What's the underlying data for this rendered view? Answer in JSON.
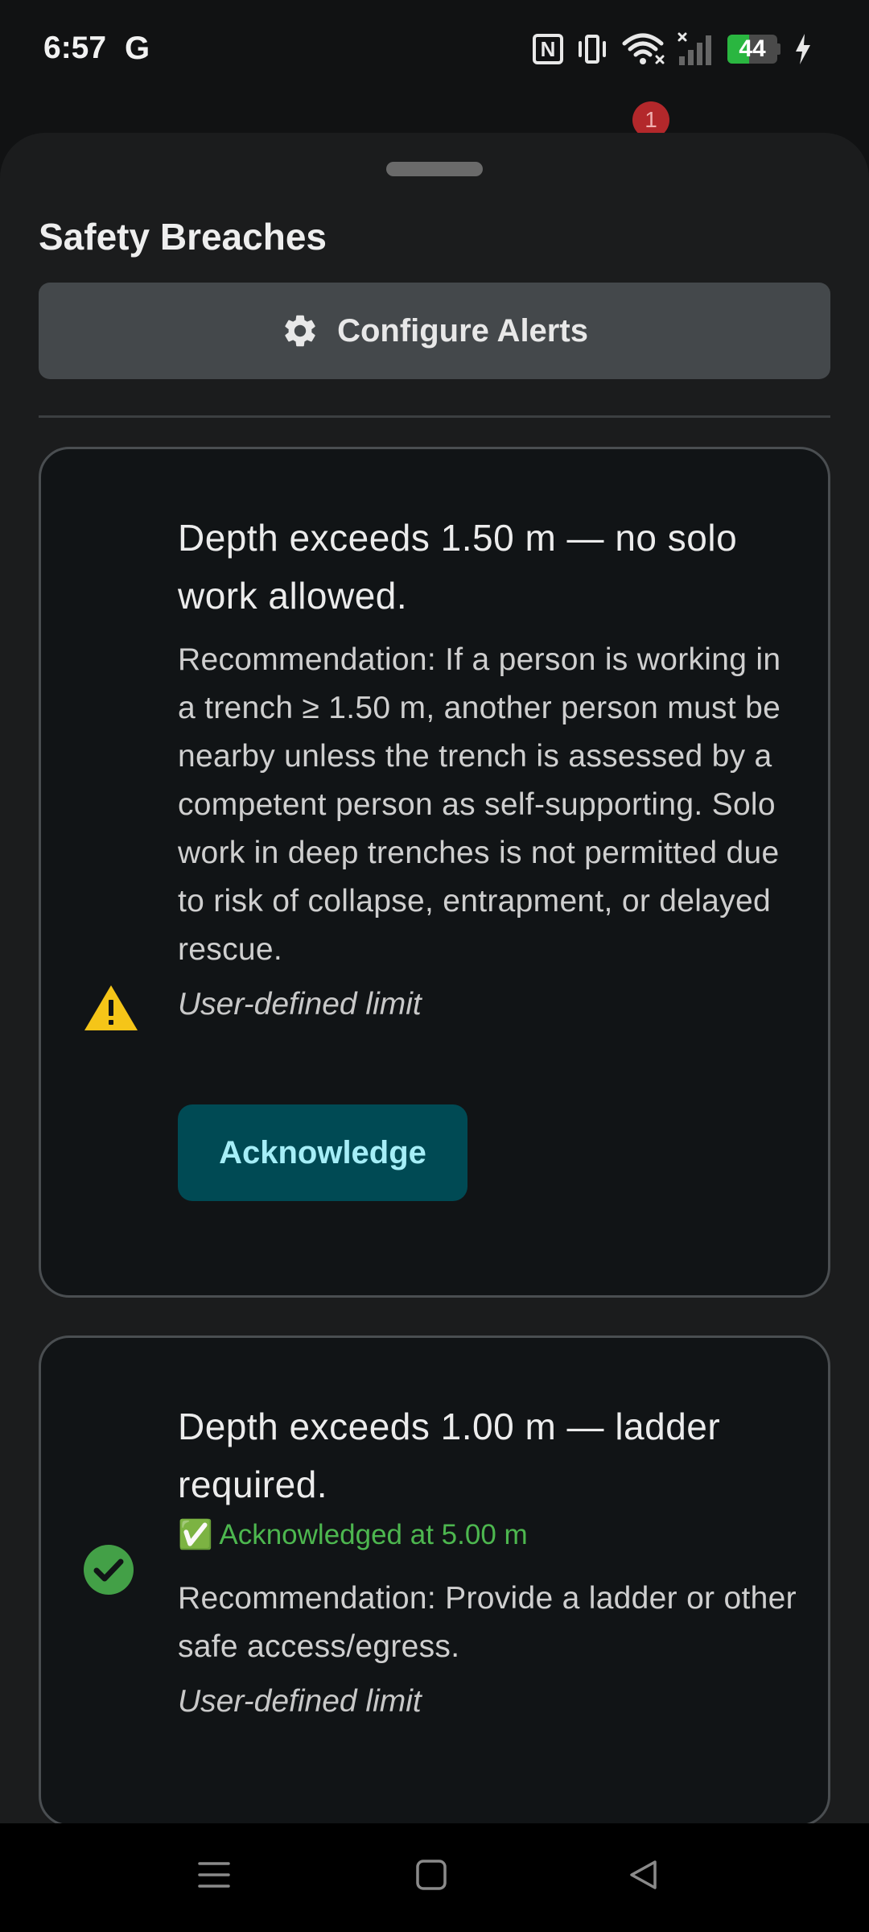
{
  "status_bar": {
    "time": "6:57",
    "google_letter": "G",
    "battery_percent": "44",
    "battery_level": 0.44,
    "icons": [
      "nfc-icon",
      "vibrate-icon",
      "wifi-icon",
      "signal-icon",
      "battery-icon",
      "charging-icon"
    ]
  },
  "background": {
    "notification_badge": "1"
  },
  "sheet": {
    "title": "Safety Breaches",
    "configure_label": "Configure Alerts",
    "configure_icon": "gear-icon"
  },
  "breaches": [
    {
      "title": "Depth exceeds 1.50 m — no solo work allowed.",
      "recommendation": "Recommendation: If a person is working in a trench ≥ 1.50 m, another person must be nearby unless the trench is assessed by a competent person as self-supporting. Solo work in deep trenches is not permitted due to risk of collapse, entrapment, or delayed rescue.",
      "limit": "User-defined limit",
      "action_label": "Acknowledge",
      "icon": "warning-icon",
      "icon_color": "#f5c518"
    },
    {
      "title": "Depth exceeds 1.00 m — ladder required.",
      "ack_status": "✅ Acknowledged at 5.00 m",
      "recommendation": "Recommendation: Provide a ladder or other safe access/egress.",
      "limit": "User-defined limit",
      "icon": "check-circle-icon",
      "icon_color": "#43a047"
    }
  ],
  "colors": {
    "sheet_background": "#1b1c1d",
    "card_background": "#111416",
    "acknowledge_button": "#004a54",
    "acknowledged_text": "#4db74f"
  },
  "nav_bar": {
    "icons": [
      "menu-icon",
      "home-icon",
      "back-icon"
    ]
  }
}
